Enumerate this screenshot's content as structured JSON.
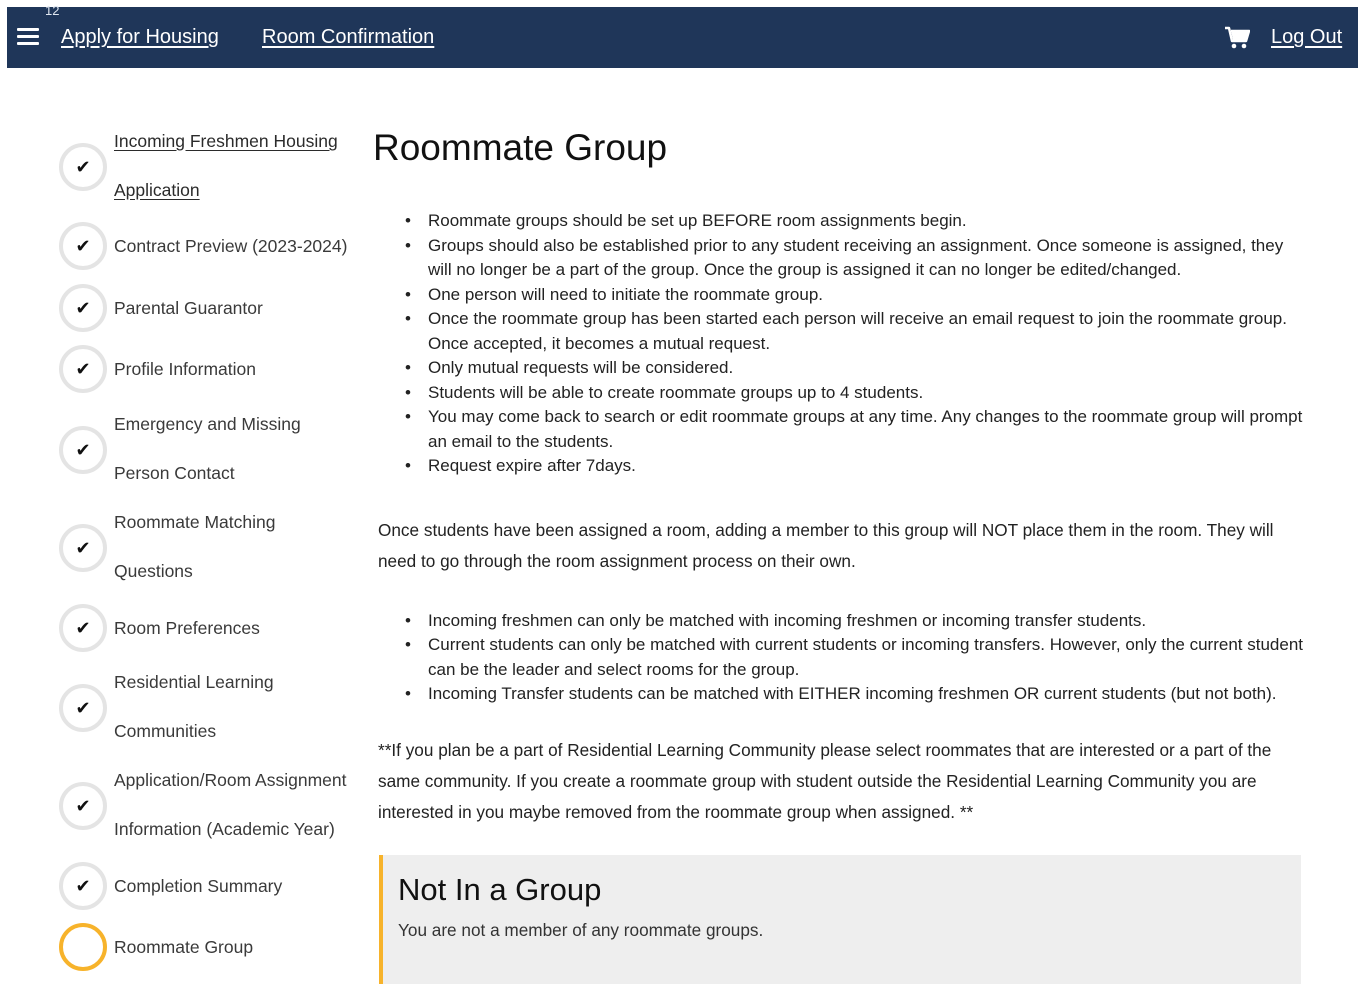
{
  "header": {
    "tiny_text": "12",
    "nav": [
      "Apply for Housing",
      "Room Confirmation"
    ],
    "logout_label": "Log Out",
    "menu_icon": "hamburger-menu-icon",
    "cart_icon": "shopping-cart-icon"
  },
  "sidebar": {
    "steps": [
      {
        "line1": "Incoming Freshmen Housing",
        "line2": "Application",
        "status": "complete"
      },
      {
        "line1": "Contract Preview (2023-2024)",
        "line2": "",
        "status": "complete"
      },
      {
        "line1": "Parental Guarantor",
        "line2": "",
        "status": "complete"
      },
      {
        "line1": "Profile Information",
        "line2": "",
        "status": "complete"
      },
      {
        "line1": "Emergency and Missing",
        "line2": "Person Contact",
        "status": "complete"
      },
      {
        "line1": "Roommate Matching",
        "line2": "Questions",
        "status": "complete"
      },
      {
        "line1": "Room Preferences",
        "line2": "",
        "status": "complete"
      },
      {
        "line1": "Residential Learning",
        "line2": "Communities",
        "status": "complete"
      },
      {
        "line1": "Application/Room Assignment",
        "line2": "Information (Academic Year)",
        "status": "complete"
      },
      {
        "line1": "Completion Summary",
        "line2": "",
        "status": "complete"
      },
      {
        "line1": "Roommate Group",
        "line2": "",
        "status": "current"
      }
    ],
    "check_glyph": "✔",
    "current_color": "#f7b32b"
  },
  "main": {
    "title": "Roommate Group",
    "rules": [
      "Roommate groups should be set up BEFORE room assignments begin.",
      "Groups should also be established prior to any student receiving an assignment. Once someone is assigned, they will no longer be a part of the group. Once the group is assigned it can no longer be edited/changed.",
      "One person will need to initiate the roommate group.",
      "Once the roommate group has been started each person will receive an email request to join the roommate group. Once accepted, it becomes a mutual request.",
      "Only mutual requests will be considered.",
      "Students will be able to create roommate groups up to 4 students.",
      "You may come back to search or edit roommate groups at any time. Any changes to the roommate group will prompt an email to the students.",
      "Request expire after 7days."
    ],
    "paragraph": "Once students have been assigned a room, adding a member to this group will NOT place them in the room. They will need to go through the room assignment process on their own.",
    "rules2": [
      "Incoming freshmen can only be matched with incoming freshmen or incoming transfer students.",
      "Current students can only be matched with current students or incoming transfers. However, only the current student can be the leader and select rooms for the group.",
      "Incoming Transfer students can be matched with EITHER incoming freshmen OR current students (but not both)."
    ],
    "note": "**If you plan be a part of Residential Learning Community please select roommates that are interested or a part of the same community. If you create a roommate group with student outside the Residential Learning Community you are interested in you maybe removed from the roommate group when assigned. **",
    "group_box": {
      "heading": "Not In a Group",
      "text": "You are not a member of any roommate groups."
    }
  }
}
